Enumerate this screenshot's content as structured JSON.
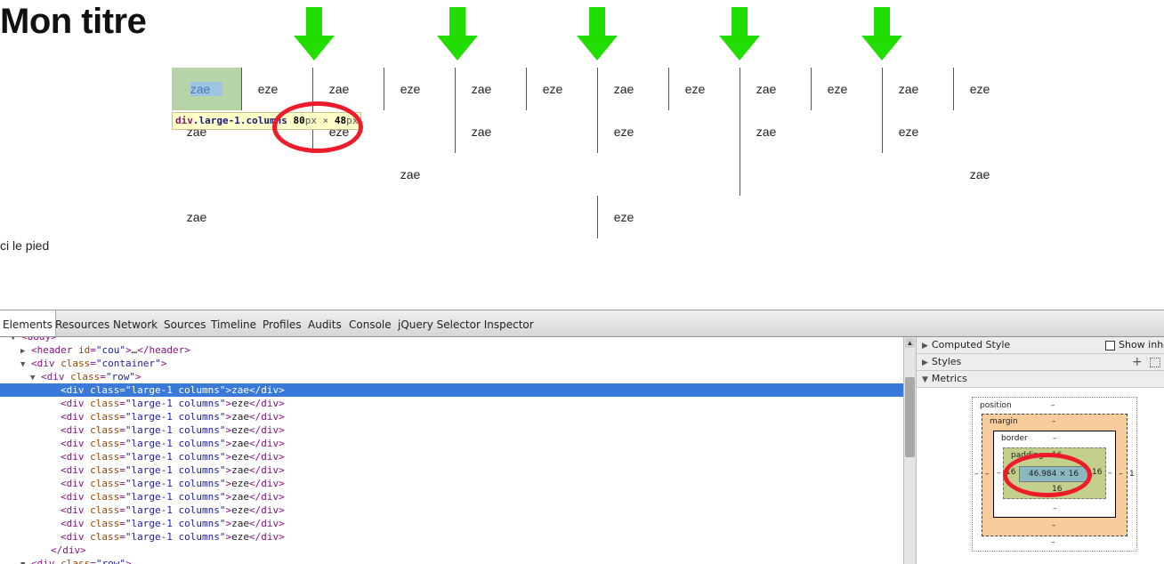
{
  "page": {
    "title": "Mon titre",
    "footer": "ci le pied",
    "rows": [
      [
        "zae",
        "eze",
        "zae",
        "eze",
        "zae",
        "eze",
        "zae",
        "eze",
        "zae",
        "eze",
        "zae",
        "eze"
      ],
      [
        "zae",
        "eze",
        "zae",
        "eze",
        "zae",
        "eze"
      ],
      [
        "zae",
        "zae"
      ],
      [
        "zae",
        "eze"
      ]
    ],
    "tooltip": {
      "tag": "div",
      "cls": ".large-1.columns",
      "width": "80",
      "unit1": "px",
      "times": "×",
      "height": "48",
      "unit2": "px"
    }
  },
  "colors": {
    "arrow": "#22dd00",
    "guide_line": "#d62020",
    "circle": "#ee1c2b",
    "selection": "#3879d9"
  },
  "devtools": {
    "tabs": [
      "Elements",
      "Resources",
      "Network",
      "Sources",
      "Timeline",
      "Profiles",
      "Audits",
      "Console",
      "jQuery Selector Inspector"
    ],
    "tree": [
      {
        "indent": 0,
        "tri": "▼",
        "parts": [
          [
            "tg",
            "<body>"
          ]
        ]
      },
      {
        "indent": 1,
        "tri": "▶",
        "parts": [
          [
            "tg",
            "<header "
          ],
          [
            "an",
            "id"
          ],
          [
            "tg",
            "="
          ],
          [
            "av",
            "\"cou\""
          ],
          [
            "tg",
            ">"
          ],
          [
            "tx",
            "…"
          ],
          [
            "tg",
            "</header>"
          ]
        ]
      },
      {
        "indent": 1,
        "tri": "▼",
        "parts": [
          [
            "tg",
            "<div "
          ],
          [
            "an",
            "class"
          ],
          [
            "tg",
            "="
          ],
          [
            "av",
            "\"container\""
          ],
          [
            "tg",
            ">"
          ]
        ]
      },
      {
        "indent": 2,
        "tri": "▼",
        "parts": [
          [
            "tg",
            "<div "
          ],
          [
            "an",
            "class"
          ],
          [
            "tg",
            "="
          ],
          [
            "av",
            "\"row\""
          ],
          [
            "tg",
            ">"
          ]
        ]
      },
      {
        "indent": 3,
        "tri": "",
        "selected": true,
        "parts": [
          [
            "tg",
            "<div "
          ],
          [
            "an",
            "class"
          ],
          [
            "tg",
            "="
          ],
          [
            "av",
            "\"large-1 columns\""
          ],
          [
            "tg",
            ">"
          ],
          [
            "tx",
            "zae"
          ],
          [
            "tg",
            "</div>"
          ]
        ]
      },
      {
        "indent": 3,
        "tri": "",
        "parts": [
          [
            "tg",
            "<div "
          ],
          [
            "an",
            "class"
          ],
          [
            "tg",
            "="
          ],
          [
            "av",
            "\"large-1 columns\""
          ],
          [
            "tg",
            ">"
          ],
          [
            "tx",
            "eze"
          ],
          [
            "tg",
            "</div>"
          ]
        ]
      },
      {
        "indent": 3,
        "tri": "",
        "parts": [
          [
            "tg",
            "<div "
          ],
          [
            "an",
            "class"
          ],
          [
            "tg",
            "="
          ],
          [
            "av",
            "\"large-1 columns\""
          ],
          [
            "tg",
            ">"
          ],
          [
            "tx",
            "zae"
          ],
          [
            "tg",
            "</div>"
          ]
        ]
      },
      {
        "indent": 3,
        "tri": "",
        "parts": [
          [
            "tg",
            "<div "
          ],
          [
            "an",
            "class"
          ],
          [
            "tg",
            "="
          ],
          [
            "av",
            "\"large-1 columns\""
          ],
          [
            "tg",
            ">"
          ],
          [
            "tx",
            "eze"
          ],
          [
            "tg",
            "</div>"
          ]
        ]
      },
      {
        "indent": 3,
        "tri": "",
        "parts": [
          [
            "tg",
            "<div "
          ],
          [
            "an",
            "class"
          ],
          [
            "tg",
            "="
          ],
          [
            "av",
            "\"large-1 columns\""
          ],
          [
            "tg",
            ">"
          ],
          [
            "tx",
            "zae"
          ],
          [
            "tg",
            "</div>"
          ]
        ]
      },
      {
        "indent": 3,
        "tri": "",
        "parts": [
          [
            "tg",
            "<div "
          ],
          [
            "an",
            "class"
          ],
          [
            "tg",
            "="
          ],
          [
            "av",
            "\"large-1 columns\""
          ],
          [
            "tg",
            ">"
          ],
          [
            "tx",
            "eze"
          ],
          [
            "tg",
            "</div>"
          ]
        ]
      },
      {
        "indent": 3,
        "tri": "",
        "parts": [
          [
            "tg",
            "<div "
          ],
          [
            "an",
            "class"
          ],
          [
            "tg",
            "="
          ],
          [
            "av",
            "\"large-1 columns\""
          ],
          [
            "tg",
            ">"
          ],
          [
            "tx",
            "zae"
          ],
          [
            "tg",
            "</div>"
          ]
        ]
      },
      {
        "indent": 3,
        "tri": "",
        "parts": [
          [
            "tg",
            "<div "
          ],
          [
            "an",
            "class"
          ],
          [
            "tg",
            "="
          ],
          [
            "av",
            "\"large-1 columns\""
          ],
          [
            "tg",
            ">"
          ],
          [
            "tx",
            "eze"
          ],
          [
            "tg",
            "</div>"
          ]
        ]
      },
      {
        "indent": 3,
        "tri": "",
        "parts": [
          [
            "tg",
            "<div "
          ],
          [
            "an",
            "class"
          ],
          [
            "tg",
            "="
          ],
          [
            "av",
            "\"large-1 columns\""
          ],
          [
            "tg",
            ">"
          ],
          [
            "tx",
            "zae"
          ],
          [
            "tg",
            "</div>"
          ]
        ]
      },
      {
        "indent": 3,
        "tri": "",
        "parts": [
          [
            "tg",
            "<div "
          ],
          [
            "an",
            "class"
          ],
          [
            "tg",
            "="
          ],
          [
            "av",
            "\"large-1 columns\""
          ],
          [
            "tg",
            ">"
          ],
          [
            "tx",
            "eze"
          ],
          [
            "tg",
            "</div>"
          ]
        ]
      },
      {
        "indent": 3,
        "tri": "",
        "parts": [
          [
            "tg",
            "<div "
          ],
          [
            "an",
            "class"
          ],
          [
            "tg",
            "="
          ],
          [
            "av",
            "\"large-1 columns\""
          ],
          [
            "tg",
            ">"
          ],
          [
            "tx",
            "zae"
          ],
          [
            "tg",
            "</div>"
          ]
        ]
      },
      {
        "indent": 3,
        "tri": "",
        "parts": [
          [
            "tg",
            "<div "
          ],
          [
            "an",
            "class"
          ],
          [
            "tg",
            "="
          ],
          [
            "av",
            "\"large-1 columns\""
          ],
          [
            "tg",
            ">"
          ],
          [
            "tx",
            "eze"
          ],
          [
            "tg",
            "</div>"
          ]
        ]
      },
      {
        "indent": 2,
        "tri": "",
        "parts": [
          [
            "tg",
            "</div>"
          ]
        ]
      },
      {
        "indent": 1,
        "tri": "▼",
        "parts": [
          [
            "tg",
            "<div "
          ],
          [
            "an",
            "class"
          ],
          [
            "tg",
            "="
          ],
          [
            "av",
            "\"row\""
          ],
          [
            "tg",
            ">"
          ]
        ]
      }
    ],
    "sidebar": {
      "computed": "Computed Style",
      "show_inherited": "Show inhe",
      "styles": "Styles",
      "metrics": "Metrics",
      "box": {
        "position_label": "position",
        "position_val": "–",
        "margin_label": "margin",
        "margin_top": "–",
        "margin_bottom": "–",
        "margin_left": "–",
        "margin_right": "–",
        "border_label": "border",
        "border_top": "–",
        "border_bottom": "–",
        "border_left": "–",
        "border_right": "–",
        "padding_label": "padding",
        "padding_top": "16",
        "padding_bottom": "16",
        "padding_left": "16",
        "padding_right": "16",
        "content": "46.984 × 16",
        "pos_left": "–",
        "pos_right": "1",
        "pos_bottom": "–"
      }
    }
  }
}
